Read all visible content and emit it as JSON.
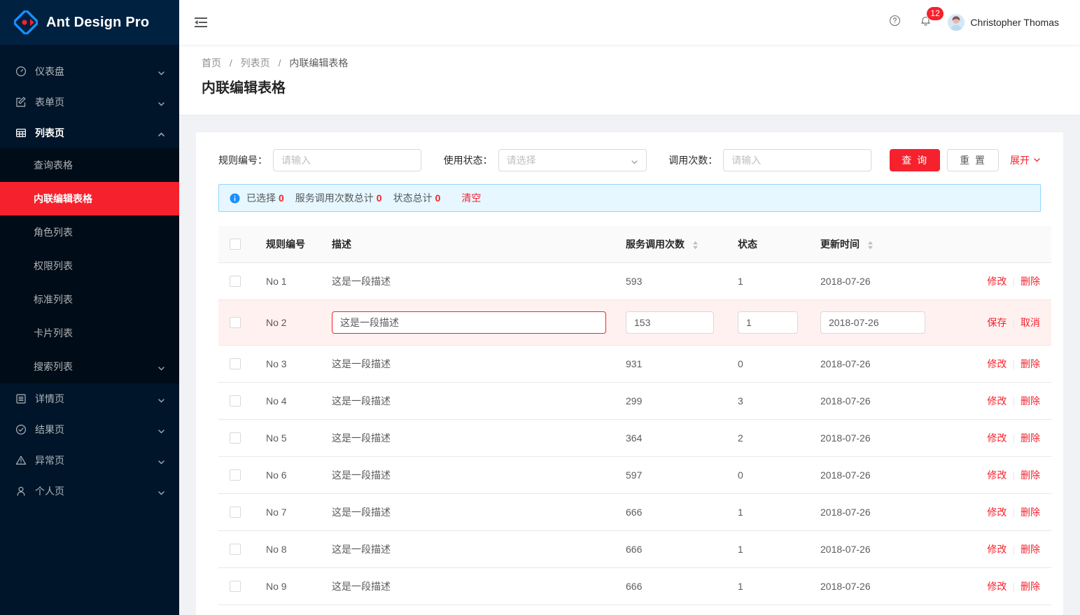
{
  "brand": {
    "name": "Ant Design Pro",
    "logo_icon": "ant-design-logo"
  },
  "sidebar": {
    "items": [
      {
        "label": "仪表盘",
        "icon": "dashboard-icon",
        "arrow": "chevron-down-icon",
        "state": "collapsed"
      },
      {
        "label": "表单页",
        "icon": "form-edit-icon",
        "arrow": "chevron-down-icon",
        "state": "collapsed"
      },
      {
        "label": "列表页",
        "icon": "table-icon",
        "arrow": "chevron-up-icon",
        "state": "expanded"
      }
    ],
    "sub_items": [
      {
        "label": "查询表格",
        "selected": false
      },
      {
        "label": "内联编辑表格",
        "selected": true
      },
      {
        "label": "角色列表",
        "selected": false
      },
      {
        "label": "权限列表",
        "selected": false
      },
      {
        "label": "标准列表",
        "selected": false
      },
      {
        "label": "卡片列表",
        "selected": false
      },
      {
        "label": "搜索列表",
        "selected": false,
        "arrow": "chevron-down-icon"
      }
    ],
    "items_after": [
      {
        "label": "详情页",
        "icon": "profile-icon",
        "arrow": "chevron-down-icon"
      },
      {
        "label": "结果页",
        "icon": "check-circle-icon",
        "arrow": "chevron-down-icon"
      },
      {
        "label": "异常页",
        "icon": "warning-icon",
        "arrow": "chevron-down-icon"
      },
      {
        "label": "个人页",
        "icon": "user-icon",
        "arrow": "chevron-down-icon"
      }
    ]
  },
  "topbar": {
    "fold_icon": "menu-fold-icon",
    "help_icon": "question-circle-icon",
    "bell_icon": "bell-icon",
    "notification_count": "12",
    "avatar_icon": "avatar",
    "user_name": "Christopher Thomas"
  },
  "page": {
    "breadcrumb": [
      "首页",
      "列表页",
      "内联编辑表格"
    ],
    "breadcrumb_separator": "/",
    "title": "内联编辑表格"
  },
  "filters": {
    "rule_no": {
      "label": "规则编号",
      "placeholder": "请输入",
      "value": ""
    },
    "status": {
      "label": "使用状态",
      "placeholder": "请选择",
      "value": "",
      "arrow_icon": "chevron-down-icon"
    },
    "calls": {
      "label": "调用次数",
      "placeholder": "请输入",
      "value": ""
    },
    "search_label": "查 询",
    "reset_label": "重 置",
    "expand_label": "展开",
    "expand_icon": "chevron-down-icon"
  },
  "alert": {
    "info_icon": "info-circle-icon",
    "selected_label": "已选择",
    "selected_count": "0",
    "calls_total_label": "服务调用次数总计",
    "calls_total": "0",
    "status_total_label": "状态总计",
    "status_total": "0",
    "clear_label": "清空"
  },
  "table": {
    "columns": [
      {
        "key": "check",
        "label": ""
      },
      {
        "key": "no",
        "label": "规则编号"
      },
      {
        "key": "desc",
        "label": "描述"
      },
      {
        "key": "calls",
        "label": "服务调用次数",
        "sortable": true,
        "sort_icon": "sort-icon"
      },
      {
        "key": "state",
        "label": "状态"
      },
      {
        "key": "time",
        "label": "更新时间",
        "sortable": true,
        "sort_icon": "sort-icon"
      },
      {
        "key": "actions",
        "label": ""
      }
    ],
    "edit_action_label": "修改",
    "delete_action_label": "删除",
    "save_action_label": "保存",
    "cancel_action_label": "取消",
    "rows": [
      {
        "no": "No 1",
        "desc": "这是一段描述",
        "calls": "593",
        "state": "1",
        "time": "2018-07-26",
        "editing": false
      },
      {
        "no": "No 2",
        "desc": "这是一段描述",
        "calls": "153",
        "state": "1",
        "time": "2018-07-26",
        "editing": true
      },
      {
        "no": "No 3",
        "desc": "这是一段描述",
        "calls": "931",
        "state": "0",
        "time": "2018-07-26",
        "editing": false
      },
      {
        "no": "No 4",
        "desc": "这是一段描述",
        "calls": "299",
        "state": "3",
        "time": "2018-07-26",
        "editing": false
      },
      {
        "no": "No 5",
        "desc": "这是一段描述",
        "calls": "364",
        "state": "2",
        "time": "2018-07-26",
        "editing": false
      },
      {
        "no": "No 6",
        "desc": "这是一段描述",
        "calls": "597",
        "state": "0",
        "time": "2018-07-26",
        "editing": false
      },
      {
        "no": "No 7",
        "desc": "这是一段描述",
        "calls": "666",
        "state": "1",
        "time": "2018-07-26",
        "editing": false
      },
      {
        "no": "No 8",
        "desc": "这是一段描述",
        "calls": "666",
        "state": "1",
        "time": "2018-07-26",
        "editing": false
      },
      {
        "no": "No 9",
        "desc": "这是一段描述",
        "calls": "666",
        "state": "1",
        "time": "2018-07-26",
        "editing": false
      }
    ]
  },
  "colors": {
    "primary_red": "#f5222d",
    "sidebar_bg": "#001529",
    "sidebar_logo_bg": "#002140",
    "submenu_bg": "#000c17",
    "alert_bg": "#e6f7ff",
    "alert_border": "#91d5ff",
    "editing_row_bg": "#fff1f0",
    "page_bg": "#f0f2f5"
  }
}
